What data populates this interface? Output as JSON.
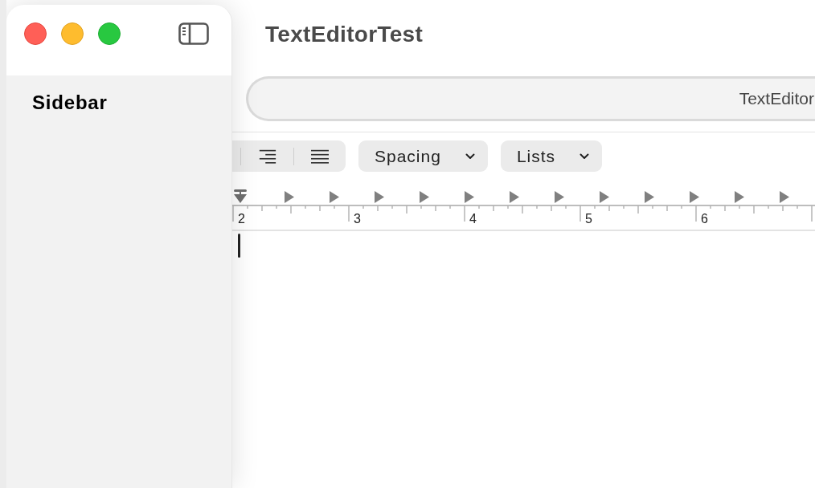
{
  "window": {
    "title": "TextEditorTest"
  },
  "sidebar": {
    "title": "Sidebar"
  },
  "toolbar": {
    "field_text": "TextEditor"
  },
  "format_bar": {
    "dropdowns": [
      {
        "label": "Spacing"
      },
      {
        "label": "Lists"
      }
    ]
  },
  "ruler": {
    "labels": [
      "2",
      "3",
      "4",
      "5",
      "6"
    ]
  }
}
